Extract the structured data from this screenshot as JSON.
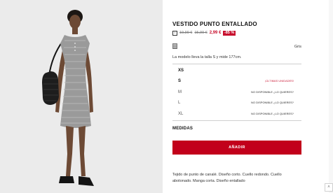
{
  "product": {
    "title": "VESTIDO PUNTO ENTALLADO",
    "info_icon": "i",
    "price_original_1": "19,99 €",
    "price_original_2": "15,99 €",
    "price_current": "2,99 €",
    "discount": "-85 %",
    "color_name": "Gris",
    "model_note": "La modelo lleva la talla S y mide 177cm.",
    "description": "Tejido de punto de canalé. Diseño corto. Cuello redondo. Cuello abotonado. Manga corta. Diseño entallado"
  },
  "sizes": [
    {
      "label": "XS",
      "status": ""
    },
    {
      "label": "S",
      "status": "¡ÚLTIMAS UNIDADES!"
    },
    {
      "label": "M",
      "status": "NO DISPONIBLE ¿LO QUIERES?"
    },
    {
      "label": "L",
      "status": "NO DISPONIBLE ¿LO QUIERES?"
    },
    {
      "label": "XL",
      "status": "NO DISPONIBLE ¿LO QUIERES?"
    }
  ],
  "actions": {
    "medidas": "MEDIDAS",
    "add": "AÑADIR",
    "scroll_up_icon": "˄"
  },
  "colors": {
    "accent": "#c2001b",
    "sale_red": "#c8102e",
    "photo_bg": "#ebebeb"
  },
  "icons": [
    "info-icon",
    "color-swatch",
    "chevron-up-icon"
  ]
}
